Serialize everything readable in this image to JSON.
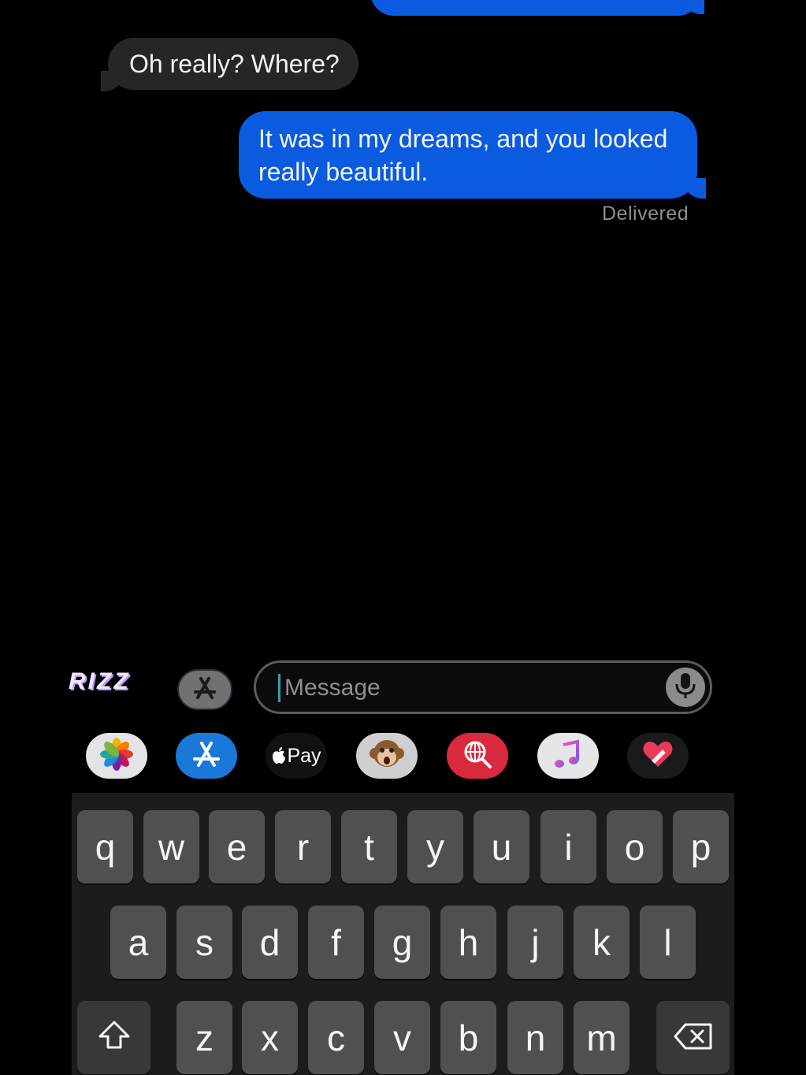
{
  "conversation": {
    "messages": [
      {
        "direction": "incoming",
        "text": "Oh really? Where?"
      },
      {
        "direction": "outgoing",
        "text": "It was in my dreams, and you looked really beautiful."
      }
    ],
    "status": "Delivered"
  },
  "input_bar": {
    "brand": "RIZZ",
    "apps_button_icon": "app-store-icon",
    "placeholder": "Message",
    "mic_icon": "microphone-icon"
  },
  "app_drawer": [
    {
      "name": "photos-icon"
    },
    {
      "name": "app-store-icon"
    },
    {
      "name": "apple-pay-icon",
      "label": "Pay"
    },
    {
      "name": "memoji-monkey-icon"
    },
    {
      "name": "web-search-icon"
    },
    {
      "name": "music-icon"
    },
    {
      "name": "digital-touch-icon"
    }
  ],
  "keyboard": {
    "row1": [
      "q",
      "w",
      "e",
      "r",
      "t",
      "y",
      "u",
      "i",
      "o",
      "p"
    ],
    "row2": [
      "a",
      "s",
      "d",
      "f",
      "g",
      "h",
      "j",
      "k",
      "l"
    ],
    "row3": [
      "z",
      "x",
      "c",
      "v",
      "b",
      "n",
      "m"
    ],
    "shift_icon": "shift-icon",
    "backspace_icon": "backspace-icon"
  },
  "colors": {
    "outgoing_bubble": "#0a5be0",
    "incoming_bubble": "#262628",
    "background": "#000000"
  }
}
